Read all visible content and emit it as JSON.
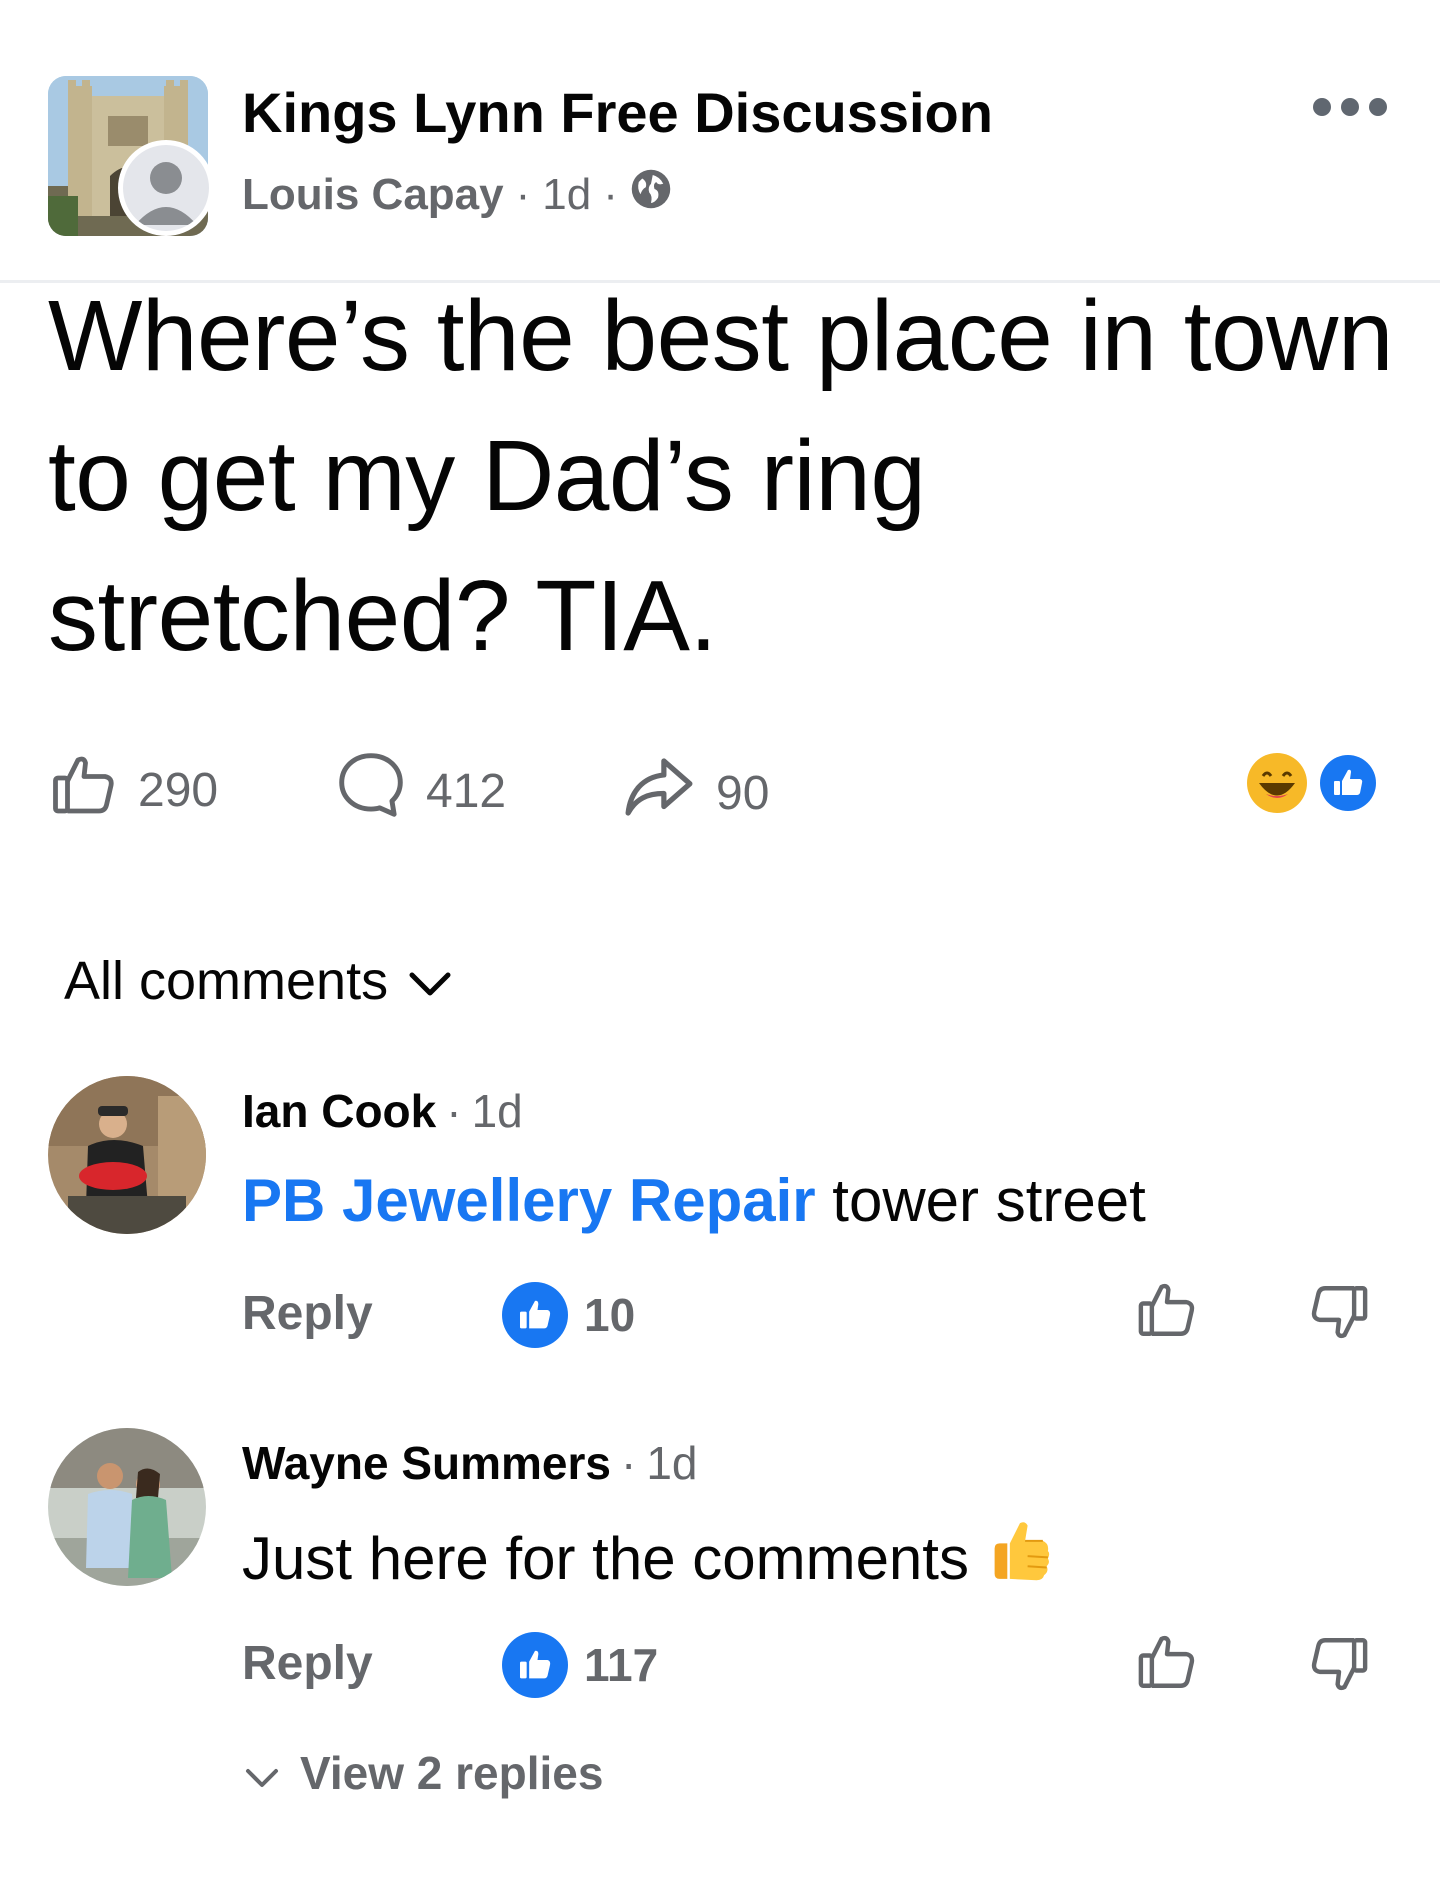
{
  "header": {
    "group_name": "Kings Lynn Free Discussion",
    "author": "Louis Capay",
    "separator": "·",
    "time": "1d",
    "separator2": "·"
  },
  "post": {
    "text": "Where’s the best place in town to get my Dad’s ring stretched? TIA."
  },
  "actions": {
    "likes": "290",
    "comments": "412",
    "shares": "90"
  },
  "comments_header": {
    "label": "All comments"
  },
  "comments": [
    {
      "name": "Ian Cook",
      "separator": "·",
      "time": "1d",
      "link_text": "PB Jewellery Repair",
      "text": " tower street",
      "reply_label": "Reply",
      "like_count": "10"
    },
    {
      "name": "Wayne Summers",
      "separator": "·",
      "time": "1d",
      "text": "Just here for the comments",
      "reply_label": "Reply",
      "like_count": "117",
      "view_replies": "View 2 replies"
    }
  ],
  "colors": {
    "accent": "#1877f2",
    "secondary_text": "#65676b",
    "primary_text": "#050505"
  },
  "icons": [
    "more-icon",
    "globe-icon",
    "like-icon",
    "comment-icon",
    "share-icon",
    "haha-reaction-icon",
    "like-reaction-icon",
    "chevron-down-icon",
    "dislike-icon",
    "thumbs-up-emoji-icon"
  ]
}
